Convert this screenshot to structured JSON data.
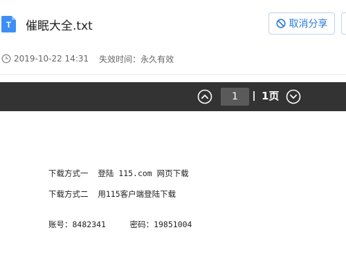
{
  "file": {
    "name": "催眠大全.txt",
    "icon_letter": "T",
    "icon_color": "#3e8ef7"
  },
  "actions": {
    "cancel_share_label": "取消分享",
    "accent_color": "#2b7bd7"
  },
  "meta": {
    "date": "2019-10-22 14:31",
    "expire_label": "失效时间：",
    "expire_value": "永久有效"
  },
  "pager": {
    "current_page": "1",
    "total_label": "1页"
  },
  "content": {
    "lines": [
      "下载方式一  登陆 115.com 网页下载",
      "下载方式二  用115客户端登陆下载",
      "账号：8482341     密码：19851004"
    ]
  }
}
